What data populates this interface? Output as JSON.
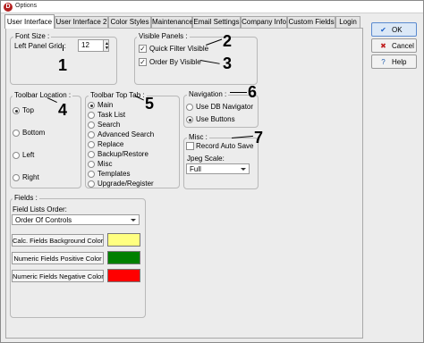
{
  "window": {
    "title": "Options"
  },
  "tabs": [
    {
      "label": "User Interface"
    },
    {
      "label": "User Interface 2"
    },
    {
      "label": "Color Styles"
    },
    {
      "label": "Maintenance"
    },
    {
      "label": "Email Settings"
    },
    {
      "label": "Company Info"
    },
    {
      "label": "Custom Fields"
    },
    {
      "label": "Login"
    }
  ],
  "font_size": {
    "title": "Font Size :",
    "grid_label": "Left Panel Grid :",
    "grid_value": "12"
  },
  "visible_panels": {
    "title": "Visible Panels :",
    "quick_filter": "Quick Filter Visible",
    "order_by": "Order By Visible"
  },
  "toolbar_location": {
    "title": "Toolbar Location :",
    "options": [
      "Top",
      "Bottom",
      "Left",
      "Right"
    ],
    "selected": "Top"
  },
  "toolbar_top_tab": {
    "title": "Toolbar Top Tab :",
    "options": [
      "Main",
      "Task List",
      "Search",
      "Advanced Search",
      "Replace",
      "Backup/Restore",
      "Misc",
      "Templates",
      "Upgrade/Register"
    ],
    "selected": "Main"
  },
  "navigation": {
    "title": "Navigation :",
    "options": [
      "Use DB Navigator",
      "Use Buttons"
    ],
    "selected": "Use Buttons"
  },
  "misc": {
    "title": "Misc :",
    "record_auto_save": "Record Auto Save",
    "jpeg_label": "Jpeg Scale:",
    "jpeg_value": "Full"
  },
  "fields": {
    "title": "Fields :",
    "list_order_label": "Field Lists Order:",
    "list_order_value": "Order Of Controls",
    "colors": [
      {
        "label": "Calc. Fields Background Color",
        "color": "#ffff80"
      },
      {
        "label": "Numeric Fields Positive Color",
        "color": "#008000"
      },
      {
        "label": "Numeric Fields Negative Color",
        "color": "#ff0000"
      }
    ]
  },
  "buttons": {
    "ok": "OK",
    "cancel": "Cancel",
    "help": "Help"
  },
  "annotations": [
    "1",
    "2",
    "3",
    "4",
    "5",
    "6",
    "7"
  ]
}
